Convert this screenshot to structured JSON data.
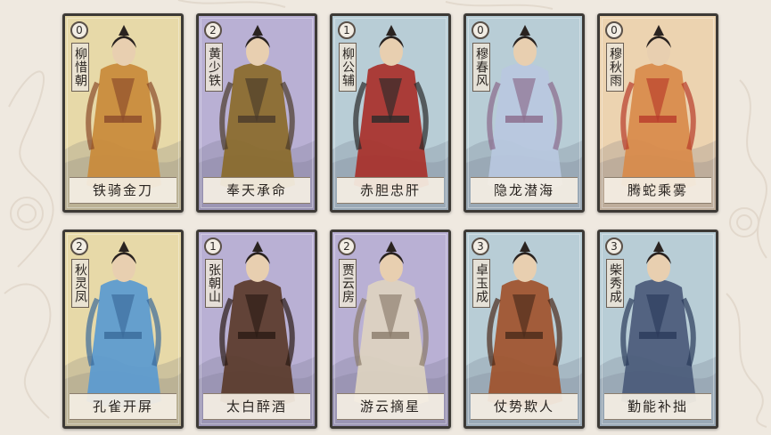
{
  "cards": [
    {
      "cost": "0",
      "name": "柳惜朝",
      "skill": "铁骑金刀",
      "bg": "#e7d9a8",
      "robe": "#c98a3a",
      "accent": "#8a4a2a"
    },
    {
      "cost": "2",
      "name": "黄少铁",
      "skill": "奉天承命",
      "bg": "#b9b0d4",
      "robe": "#8a6a2a",
      "accent": "#4a3a2a"
    },
    {
      "cost": "1",
      "name": "柳公辅",
      "skill": "赤胆忠肝",
      "bg": "#b8cdd6",
      "robe": "#a8302a",
      "accent": "#2a2a2a"
    },
    {
      "cost": "0",
      "name": "穆春风",
      "skill": "隐龙潜海",
      "bg": "#b8cdd6",
      "robe": "#b8c8e0",
      "accent": "#8a6a8a"
    },
    {
      "cost": "0",
      "name": "穆秋雨",
      "skill": "腾蛇乘雾",
      "bg": "#ecd3b0",
      "robe": "#d88a4a",
      "accent": "#b83a2a"
    },
    {
      "cost": "2",
      "name": "秋灵凤",
      "skill": "孔雀开屏",
      "bg": "#e7d9a8",
      "robe": "#5a9ad0",
      "accent": "#3a6a9a"
    },
    {
      "cost": "1",
      "name": "张朝山",
      "skill": "太白醉酒",
      "bg": "#b9b0d4",
      "robe": "#5a3a2a",
      "accent": "#2a1a14"
    },
    {
      "cost": "2",
      "name": "贾云房",
      "skill": "游云摘星",
      "bg": "#b9b0d4",
      "robe": "#ddd2c0",
      "accent": "#8a7a6a"
    },
    {
      "cost": "3",
      "name": "卓玉成",
      "skill": "仗势欺人",
      "bg": "#b8cdd6",
      "robe": "#a0522d",
      "accent": "#4a2a1a"
    },
    {
      "cost": "3",
      "name": "柴秀成",
      "skill": "勤能补拙",
      "bg": "#b8cdd6",
      "robe": "#4a5a7a",
      "accent": "#2a3a5a"
    }
  ]
}
